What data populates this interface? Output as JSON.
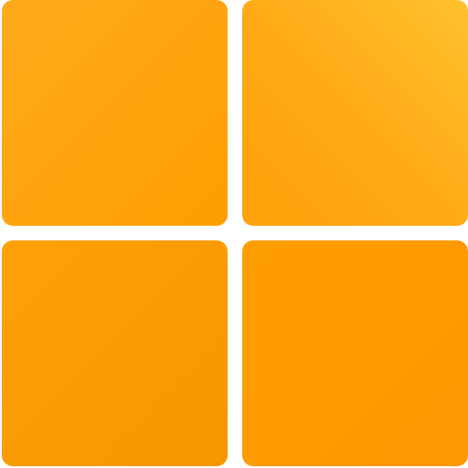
{
  "icon": {
    "name": "windows-logo-icon",
    "tiles": [
      "top-left",
      "top-right",
      "bottom-left",
      "bottom-right"
    ]
  },
  "colors": {
    "background": "#ffffff",
    "tile_orange_light": "#ffc12e",
    "tile_orange": "#ffa914",
    "tile_orange_dark": "#f79500"
  }
}
